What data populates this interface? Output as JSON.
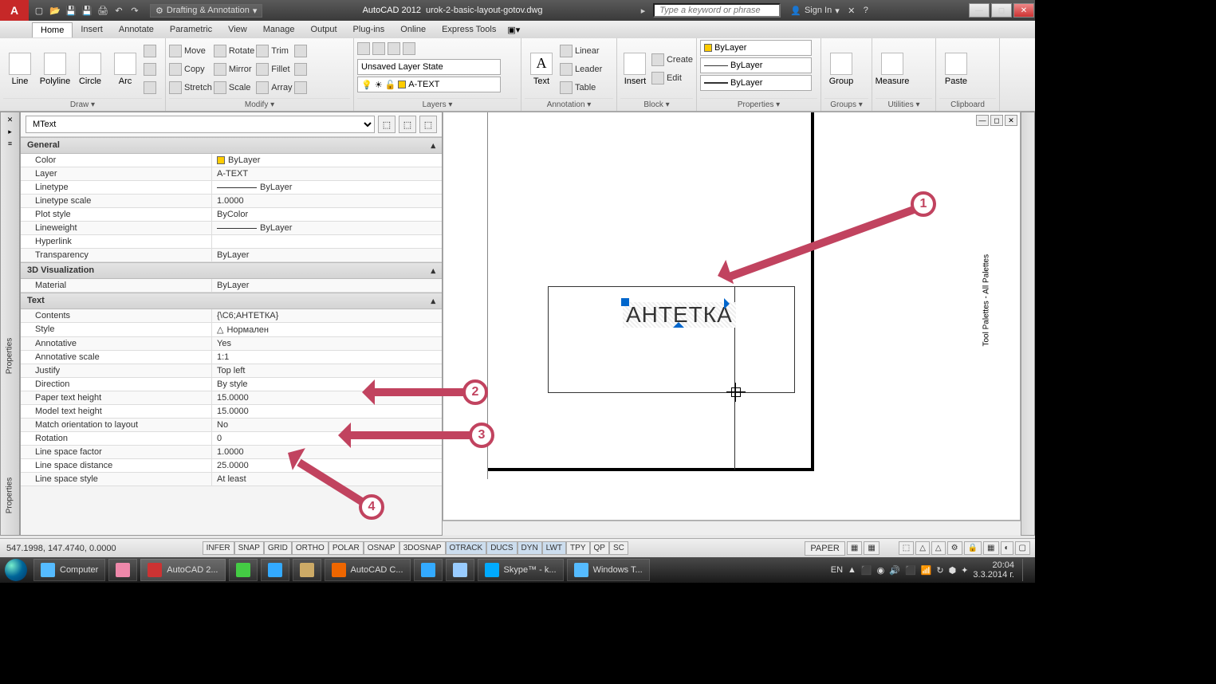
{
  "titlebar": {
    "workspace": "Drafting & Annotation",
    "app_name": "AutoCAD 2012",
    "file_name": "urok-2-basic-layout-gotov.dwg",
    "search_placeholder": "Type a keyword or phrase",
    "signin": "Sign In"
  },
  "menu": {
    "tabs": [
      "Home",
      "Insert",
      "Annotate",
      "Parametric",
      "View",
      "Manage",
      "Output",
      "Plug-ins",
      "Online",
      "Express Tools"
    ]
  },
  "ribbon": {
    "draw": {
      "title": "Draw ▾",
      "tools": [
        "Line",
        "Polyline",
        "Circle",
        "Arc"
      ]
    },
    "modify": {
      "title": "Modify ▾",
      "row1": [
        "Move",
        "Rotate",
        "Trim"
      ],
      "row2": [
        "Copy",
        "Mirror",
        "Fillet"
      ],
      "row3": [
        "Stretch",
        "Scale",
        "Array"
      ]
    },
    "layers": {
      "title": "Layers ▾",
      "state": "Unsaved Layer State",
      "current": "A-TEXT"
    },
    "annotation": {
      "title": "Annotation ▾",
      "text": "Text",
      "items": [
        "Linear",
        "Leader",
        "Table"
      ]
    },
    "block": {
      "title": "Block ▾",
      "insert": "Insert",
      "items": [
        "Create",
        "Edit"
      ]
    },
    "properties": {
      "title": "Properties ▾",
      "layer": "ByLayer",
      "lt": "ByLayer",
      "lw": "ByLayer"
    },
    "groups": {
      "title": "Groups ▾",
      "group": "Group"
    },
    "utilities": {
      "title": "Utilities ▾",
      "measure": "Measure"
    },
    "clipboard": {
      "title": "Clipboard",
      "paste": "Paste"
    }
  },
  "properties": {
    "selector": "MText",
    "sections": {
      "general": {
        "title": "General",
        "rows": [
          {
            "k": "Color",
            "v": "ByLayer",
            "swatch": "#ffcc00"
          },
          {
            "k": "Layer",
            "v": "A-TEXT"
          },
          {
            "k": "Linetype",
            "v": "ByLayer",
            "line": true
          },
          {
            "k": "Linetype scale",
            "v": "1.0000"
          },
          {
            "k": "Plot style",
            "v": "ByColor"
          },
          {
            "k": "Lineweight",
            "v": "ByLayer",
            "line": true
          },
          {
            "k": "Hyperlink",
            "v": ""
          },
          {
            "k": "Transparency",
            "v": "ByLayer"
          }
        ]
      },
      "viz": {
        "title": "3D Visualization",
        "rows": [
          {
            "k": "Material",
            "v": "ByLayer"
          }
        ]
      },
      "text": {
        "title": "Text",
        "rows": [
          {
            "k": "Contents",
            "v": "{\\C6;АНТЕТКА}"
          },
          {
            "k": "Style",
            "v": "Нормален",
            "icon": "△"
          },
          {
            "k": "Annotative",
            "v": "Yes"
          },
          {
            "k": "Annotative scale",
            "v": "1:1"
          },
          {
            "k": "Justify",
            "v": "Top left"
          },
          {
            "k": "Direction",
            "v": "By style"
          },
          {
            "k": "Paper text height",
            "v": "15.0000"
          },
          {
            "k": "Model text height",
            "v": "15.0000"
          },
          {
            "k": "Match orientation to layout",
            "v": "No"
          },
          {
            "k": "Rotation",
            "v": "0"
          },
          {
            "k": "Line space factor",
            "v": "1.0000"
          },
          {
            "k": "Line space distance",
            "v": "25.0000"
          },
          {
            "k": "Line space style",
            "v": "At least"
          }
        ]
      }
    }
  },
  "palette_label": "Properties",
  "palette_label2": "Properties",
  "tool_palette_label": "Tool Palettes - All Palettes",
  "canvas": {
    "text": "АНТЕТКА"
  },
  "callouts": [
    "1",
    "2",
    "3",
    "4"
  ],
  "status": {
    "coords": "547.1998, 147.4740, 0.0000",
    "toggles": [
      "INFER",
      "SNAP",
      "GRID",
      "ORTHO",
      "POLAR",
      "OSNAP",
      "3DOSNAP",
      "OTRACK",
      "DUCS",
      "DYN",
      "LWT",
      "TPY",
      "QP",
      "SC"
    ],
    "toggles_on": [
      "OTRACK",
      "DUCS",
      "DYN",
      "LWT"
    ],
    "space": "PAPER"
  },
  "taskbar": {
    "items": [
      {
        "label": "Computer"
      },
      {
        "label": ""
      },
      {
        "label": "AutoCAD 2..."
      },
      {
        "label": ""
      },
      {
        "label": ""
      },
      {
        "label": ""
      },
      {
        "label": "AutoCAD C..."
      },
      {
        "label": ""
      },
      {
        "label": ""
      },
      {
        "label": "Skype™ - k..."
      },
      {
        "label": "Windows T..."
      }
    ],
    "lang": "EN",
    "time": "20:04",
    "date": "3.3.2014 г."
  }
}
